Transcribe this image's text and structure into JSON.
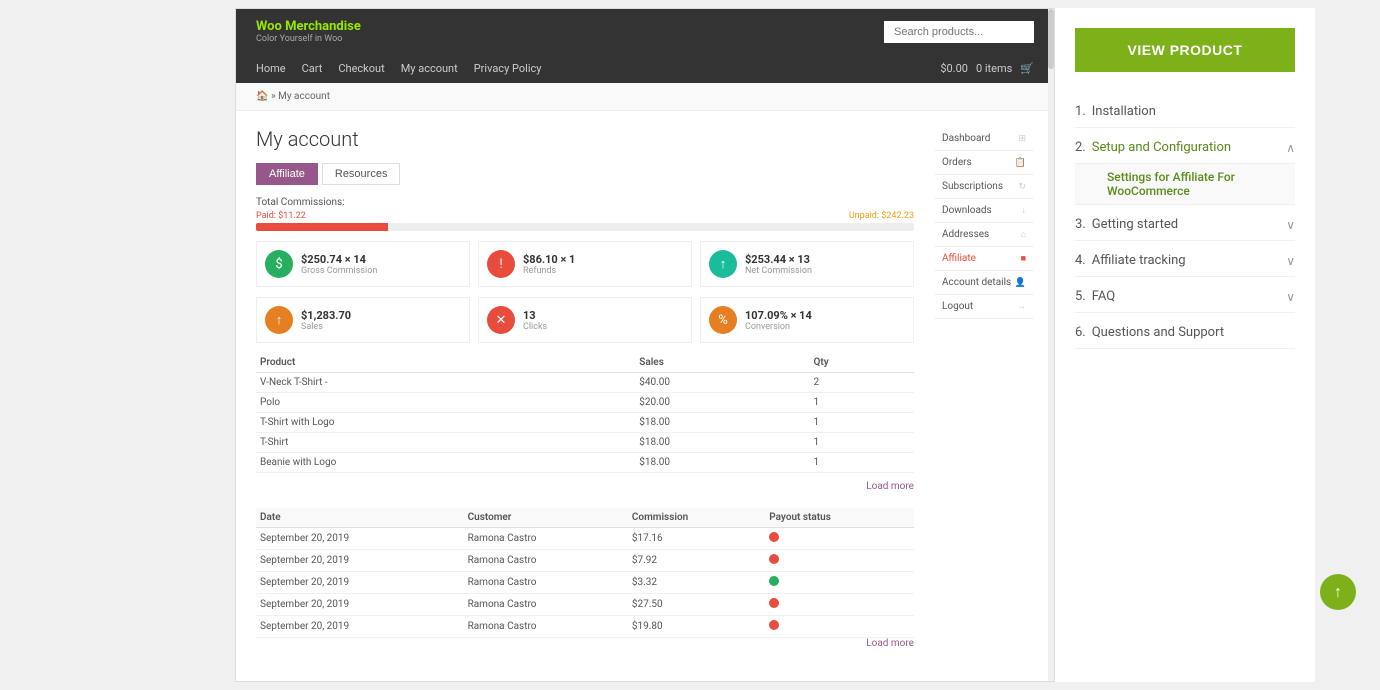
{
  "page": {
    "background_color": "#f0f0f0"
  },
  "woo": {
    "brand_title": "Woo Merchandise",
    "brand_sub": "Color Yourself in Woo",
    "search_placeholder": "Search products...",
    "nav_links": [
      "Home",
      "Cart",
      "Checkout",
      "My account",
      "Privacy Policy"
    ],
    "cart_price": "$0.00",
    "cart_items": "0 items",
    "breadcrumb_home": "Home",
    "breadcrumb_separator": "»",
    "breadcrumb_current": "My account",
    "account_title": "My account",
    "tabs": [
      "Affiliate",
      "Resources"
    ],
    "active_tab": "Affiliate",
    "commission_bar_title": "Total Commissions:",
    "commission_paid_label": "Paid: $11.22",
    "commission_unpaid_label": "Unpaid: $242.23",
    "stats": [
      {
        "icon": "$",
        "icon_color": "green",
        "value": "$250.74 × 14",
        "label": "Gross Commission"
      },
      {
        "icon": "!",
        "icon_color": "red",
        "value": "$86.10 × 1",
        "label": "Refunds"
      },
      {
        "icon": "↑",
        "icon_color": "teal",
        "value": "$253.44 × 13",
        "label": "Net Commission"
      },
      {
        "icon": "↑",
        "icon_color": "orange",
        "value": "$1,283.70",
        "label": "Sales"
      },
      {
        "icon": "✕",
        "icon_color": "red",
        "value": "13",
        "label": "Clicks"
      },
      {
        "icon": "%",
        "icon_color": "orange",
        "value": "107.09% × 14",
        "label": "Conversion"
      }
    ],
    "products_table": {
      "headers": [
        "Product",
        "Sales",
        "Qty"
      ],
      "rows": [
        {
          "product": "V-Neck T-Shirt -",
          "sales": "$40.00",
          "qty": "2"
        },
        {
          "product": "Polo",
          "sales": "$20.00",
          "qty": "1"
        },
        {
          "product": "T-Shirt with Logo",
          "sales": "$18.00",
          "qty": "1"
        },
        {
          "product": "T-Shirt",
          "sales": "$18.00",
          "qty": "1"
        },
        {
          "product": "Beanie with Logo",
          "sales": "$18.00",
          "qty": "1"
        }
      ]
    },
    "load_more": "Load more",
    "commissions_table": {
      "headers": [
        "Date",
        "Customer",
        "Commission",
        "Payout status"
      ],
      "rows": [
        {
          "date": "September 20, 2019",
          "customer": "Ramona Castro",
          "commission": "$17.16",
          "status": "red"
        },
        {
          "date": "September 20, 2019",
          "customer": "Ramona Castro",
          "commission": "$7.92",
          "status": "red"
        },
        {
          "date": "September 20, 2019",
          "customer": "Ramona Castro",
          "commission": "$3.32",
          "status": "green"
        },
        {
          "date": "September 20, 2019",
          "customer": "Ramona Castro",
          "commission": "$27.50",
          "status": "red"
        },
        {
          "date": "September 20, 2019",
          "customer": "Ramona Castro",
          "commission": "$19.80",
          "status": "red"
        }
      ]
    },
    "load_more_commissions": "Load more",
    "sidebar_menu": [
      {
        "label": "Dashboard",
        "active": false
      },
      {
        "label": "Orders",
        "active": false
      },
      {
        "label": "Subscriptions",
        "active": false
      },
      {
        "label": "Downloads",
        "active": false
      },
      {
        "label": "Addresses",
        "active": false
      },
      {
        "label": "Affiliate",
        "active": true
      },
      {
        "label": "Account details",
        "active": false
      },
      {
        "label": "Logout",
        "active": false
      }
    ]
  },
  "sidebar": {
    "view_product_label": "VIEW PRODUCT",
    "nav_items": [
      {
        "number": "1.",
        "label": "Installation",
        "expanded": false,
        "active": false,
        "sub_items": []
      },
      {
        "number": "2.",
        "label": "Setup and Configuration",
        "expanded": true,
        "active": true,
        "sub_items": [
          {
            "label": "Settings for Affiliate For WooCommerce",
            "active": true
          }
        ]
      },
      {
        "number": "3.",
        "label": "Getting started",
        "expanded": false,
        "active": false,
        "sub_items": []
      },
      {
        "number": "4.",
        "label": "Affiliate tracking",
        "expanded": false,
        "active": false,
        "sub_items": []
      },
      {
        "number": "5.",
        "label": "FAQ",
        "expanded": false,
        "active": false,
        "sub_items": []
      },
      {
        "number": "6.",
        "label": "Questions and Support",
        "expanded": false,
        "active": false,
        "sub_items": []
      }
    ]
  }
}
